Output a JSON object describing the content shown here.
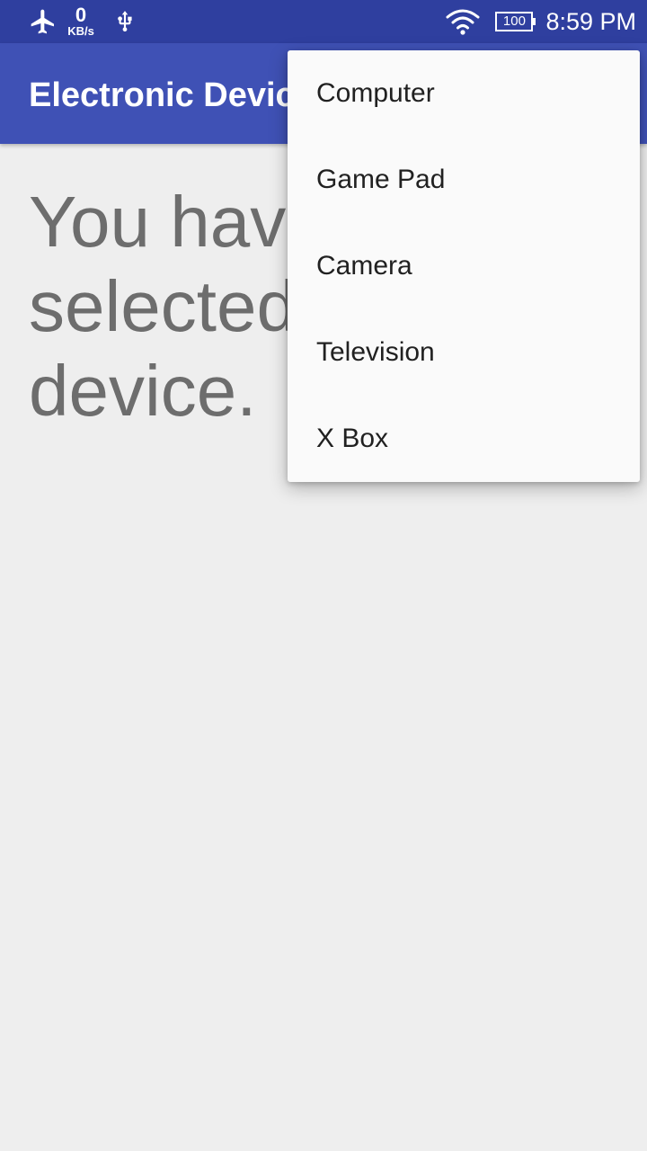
{
  "status_bar": {
    "net_speed_value": "0",
    "net_speed_unit": "KB/s",
    "battery_level": "100",
    "time": "8:59 PM",
    "background_color": "#2f3f9f",
    "icons": [
      "airplane-icon",
      "usb-icon",
      "wifi-icon",
      "battery-icon"
    ]
  },
  "app_bar": {
    "title": "Electronic Devices",
    "background_color": "#3f51b5"
  },
  "main": {
    "message": "You have not selected any device."
  },
  "menu": {
    "items": [
      {
        "label": "Computer"
      },
      {
        "label": "Game Pad"
      },
      {
        "label": "Camera"
      },
      {
        "label": "Television"
      },
      {
        "label": "X Box"
      }
    ]
  }
}
